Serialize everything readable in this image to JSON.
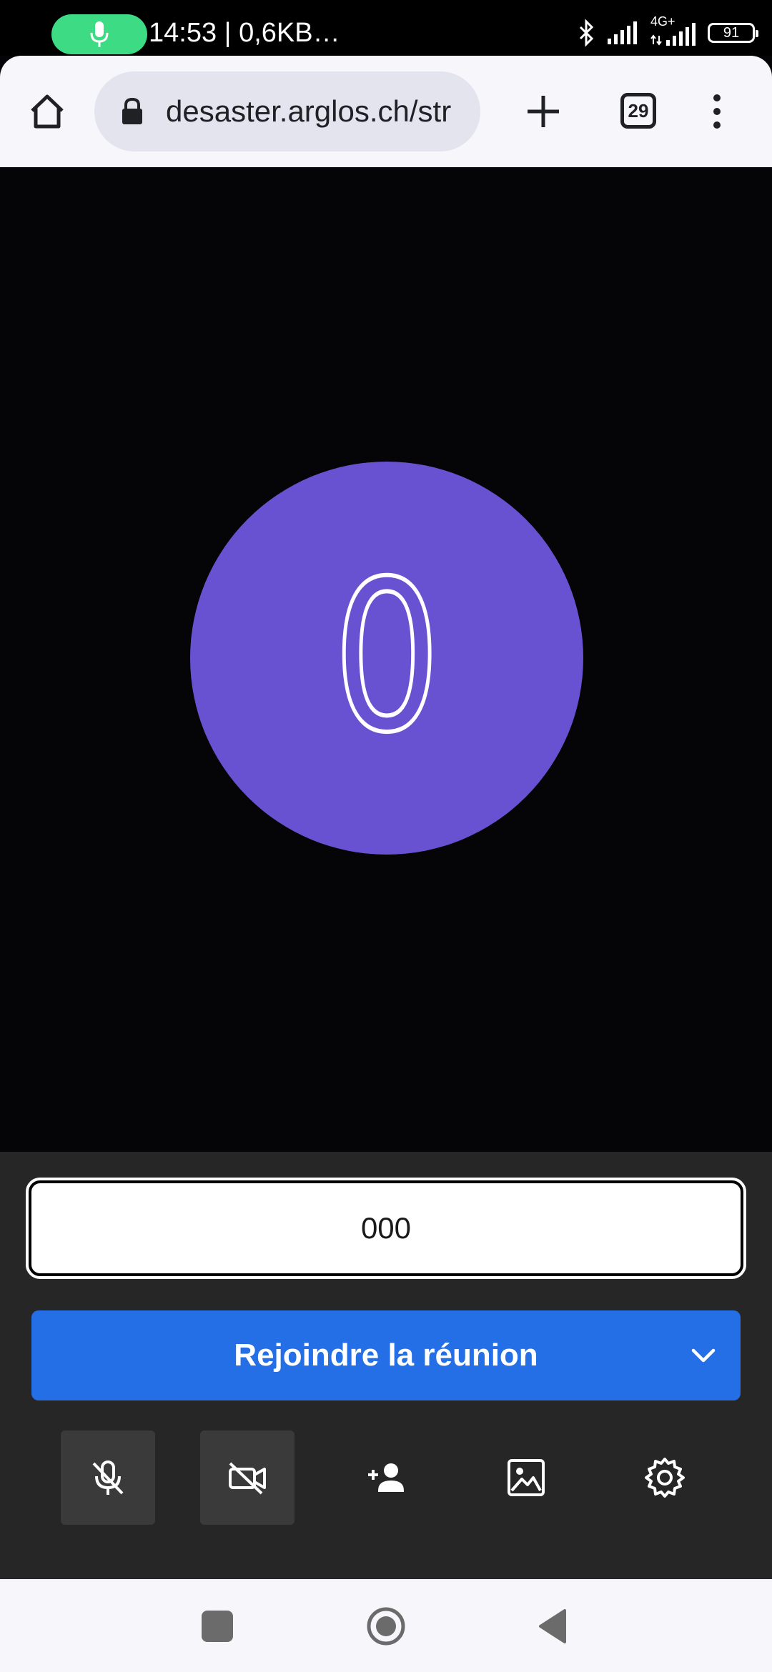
{
  "status_bar": {
    "time_and_speed": "14:53 | 0,6KB…",
    "network_label": "4G+",
    "battery_level": "91"
  },
  "browser": {
    "url": "desaster.arglos.ch/str",
    "tab_count": "29"
  },
  "meeting": {
    "avatar_initial": "0",
    "avatar_color": "#6952d1",
    "name_input_value": "000",
    "join_button_label": "Rejoindre la réunion",
    "join_button_color": "#246fe5"
  },
  "toolbar": {
    "buttons": [
      {
        "name": "mic-muted",
        "icon": "mic-off-icon"
      },
      {
        "name": "camera-off",
        "icon": "video-off-icon"
      },
      {
        "name": "invite",
        "icon": "person-add-icon"
      },
      {
        "name": "background",
        "icon": "image-icon"
      },
      {
        "name": "settings",
        "icon": "gear-icon"
      }
    ]
  }
}
